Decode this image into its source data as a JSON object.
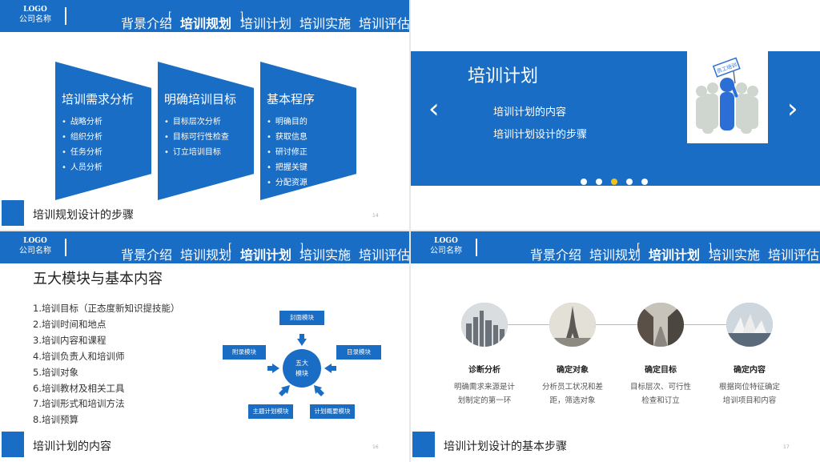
{
  "header": {
    "logo_line1": "LOGO",
    "logo_line2": "公司名称",
    "nav": [
      "背景介绍",
      "培训规划",
      "培训计划",
      "培训实施",
      "培训评估"
    ]
  },
  "slide14": {
    "active_nav": "培训规划",
    "columns": [
      {
        "title": "培训需求分析",
        "items": [
          "战略分析",
          "组织分析",
          "任务分析",
          "人员分析"
        ]
      },
      {
        "title": "明确培训目标",
        "items": [
          "目标层次分析",
          "目标可行性检查",
          "订立培训目标"
        ]
      },
      {
        "title": "基本程序",
        "items": [
          "明确目的",
          "获取信息",
          "研讨修正",
          "把握关键",
          "分配资源"
        ]
      }
    ],
    "footer_title": "培训规划设计的步骤",
    "page_number": "14"
  },
  "slide_banner": {
    "title": "培训计划",
    "items": [
      "培训计划的内容",
      "培训计划设计的步骤"
    ],
    "prev_arrow": "‹",
    "next_arrow": "›",
    "sign_text": "员工培训",
    "dots_count": 5,
    "active_dot": 3
  },
  "slide16": {
    "active_nav": "培训计划",
    "title": "五大模块与基本内容",
    "list": [
      "1.培训目标（正态度新知识提技能）",
      "2.培训时间和地点",
      "3.培训内容和课程",
      "4.培训负责人和培训师",
      "5.培训对象",
      "6.培训教材及相关工具",
      "7.培训形式和培训方法",
      "8.培训预算"
    ],
    "hub_line1": "五大",
    "hub_line2": "模块",
    "modules": {
      "top": "封面模块",
      "right": "目录模块",
      "bottom_right": "计划概要模块",
      "bottom_left": "主题计划模块",
      "left": "附录模块"
    },
    "footer_title": "培训计划的内容",
    "page_number": "16"
  },
  "slide17": {
    "active_nav": "培训计划",
    "steps": [
      {
        "title": "诊断分析",
        "desc1": "明确需求来源是计",
        "desc2": "划制定的第一环"
      },
      {
        "title": "确定对象",
        "desc1": "分析员工状况和差",
        "desc2": "距，筛选对象"
      },
      {
        "title": "确定目标",
        "desc1": "目标层次、可行性",
        "desc2": "检查和订立"
      },
      {
        "title": "确定内容",
        "desc1": "根据岗位特征确定",
        "desc2": "培训项目和内容"
      }
    ],
    "footer_title": "培训计划设计的基本步骤",
    "page_number": "17"
  },
  "colors": {
    "primary": "#1a6dc4",
    "accent_dot": "#f2c11a"
  }
}
